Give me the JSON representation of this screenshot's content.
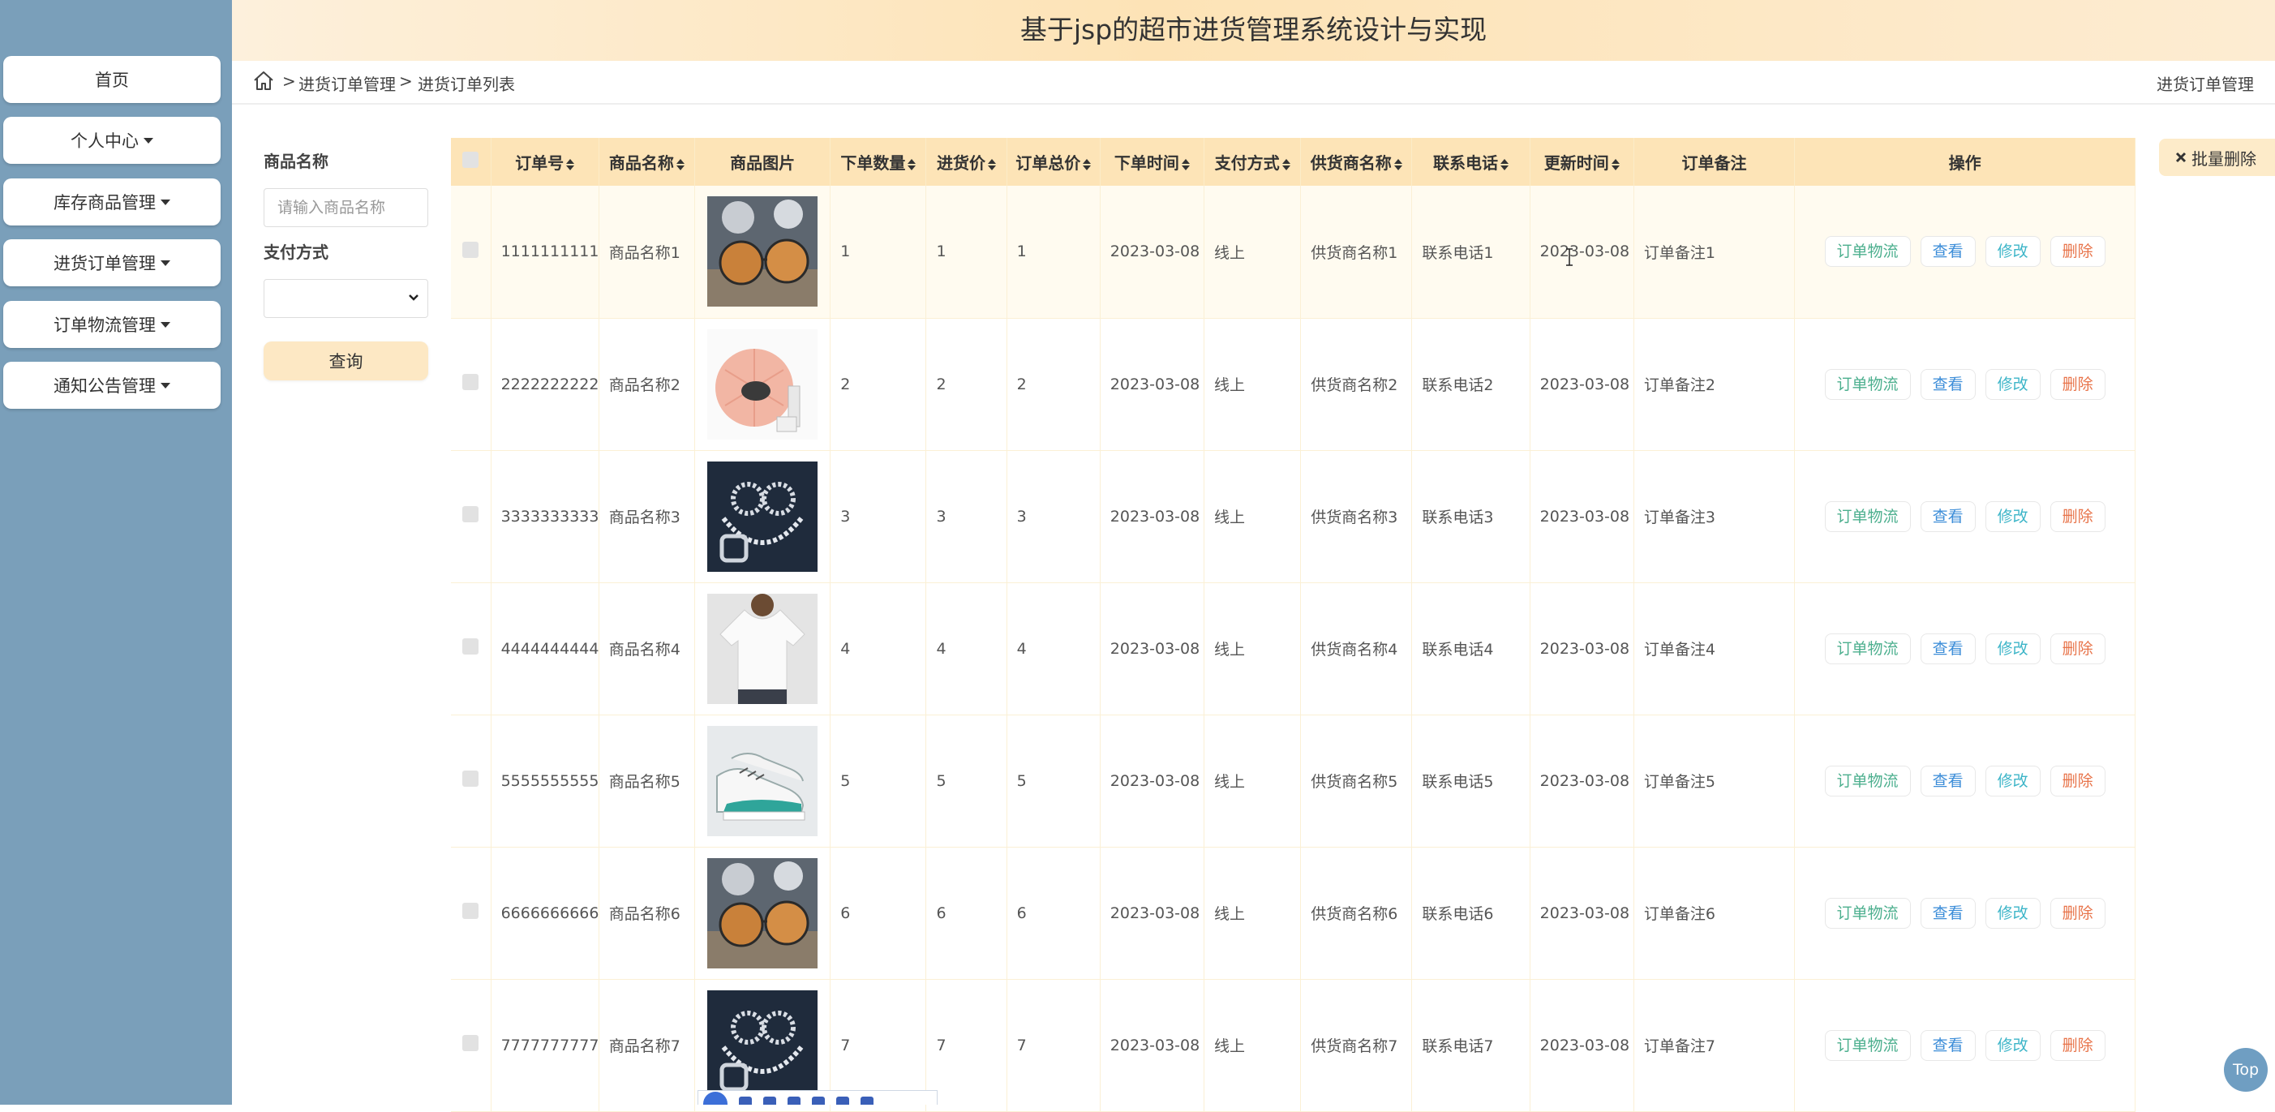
{
  "app": {
    "title": "基于jsp的超市进货管理系统设计与实现"
  },
  "sidebar": {
    "items": [
      {
        "label": "首页",
        "dropdown": false
      },
      {
        "label": "个人中心",
        "dropdown": true
      },
      {
        "label": "库存商品管理",
        "dropdown": true
      },
      {
        "label": "进货订单管理",
        "dropdown": true
      },
      {
        "label": "订单物流管理",
        "dropdown": true
      },
      {
        "label": "通知公告管理",
        "dropdown": true
      }
    ]
  },
  "breadcrumb": {
    "sep1": ">",
    "item1": "进货订单管理",
    "sep2": ">",
    "item2": "进货订单列表",
    "right": "进货订单管理"
  },
  "search": {
    "name_label": "商品名称",
    "name_placeholder": "请输入商品名称",
    "name_value": "",
    "pay_label": "支付方式",
    "pay_value": "",
    "button": "查询"
  },
  "batch_delete": {
    "icon": "times-icon",
    "label": "批量删除"
  },
  "table": {
    "headers": [
      "订单号",
      "商品名称",
      "商品图片",
      "下单数量",
      "进货价",
      "订单总价",
      "下单时间",
      "支付方式",
      "供货商名称",
      "联系电话",
      "更新时间",
      "订单备注",
      "操作"
    ],
    "actions": {
      "logistics": "订单物流",
      "view": "查看",
      "edit": "修改",
      "delete": "删除"
    },
    "rows": [
      {
        "order_no": "1111111111",
        "name": "商品名称1",
        "image": "sunglasses",
        "qty": "1",
        "price": "1",
        "total": "1",
        "date": "2023-03-08",
        "pay": "线上",
        "supplier": "供货商名称1",
        "phone": "联系电话1",
        "updated": "2023-03-08",
        "note": "订单备注1"
      },
      {
        "order_no": "2222222222",
        "name": "商品名称2",
        "image": "cosmetics",
        "qty": "2",
        "price": "2",
        "total": "2",
        "date": "2023-03-08",
        "pay": "线上",
        "supplier": "供货商名称2",
        "phone": "联系电话2",
        "updated": "2023-03-08",
        "note": "订单备注2"
      },
      {
        "order_no": "3333333333",
        "name": "商品名称3",
        "image": "jewelry",
        "qty": "3",
        "price": "3",
        "total": "3",
        "date": "2023-03-08",
        "pay": "线上",
        "supplier": "供货商名称3",
        "phone": "联系电话3",
        "updated": "2023-03-08",
        "note": "订单备注3"
      },
      {
        "order_no": "4444444444",
        "name": "商品名称4",
        "image": "tshirt",
        "qty": "4",
        "price": "4",
        "total": "4",
        "date": "2023-03-08",
        "pay": "线上",
        "supplier": "供货商名称4",
        "phone": "联系电话4",
        "updated": "2023-03-08",
        "note": "订单备注4"
      },
      {
        "order_no": "5555555555",
        "name": "商品名称5",
        "image": "sneakers",
        "qty": "5",
        "price": "5",
        "total": "5",
        "date": "2023-03-08",
        "pay": "线上",
        "supplier": "供货商名称5",
        "phone": "联系电话5",
        "updated": "2023-03-08",
        "note": "订单备注5"
      },
      {
        "order_no": "6666666666",
        "name": "商品名称6",
        "image": "sunglasses",
        "qty": "6",
        "price": "6",
        "total": "6",
        "date": "2023-03-08",
        "pay": "线上",
        "supplier": "供货商名称6",
        "phone": "联系电话6",
        "updated": "2023-03-08",
        "note": "订单备注6"
      },
      {
        "order_no": "7777777777",
        "name": "商品名称7",
        "image": "jewelry",
        "qty": "7",
        "price": "7",
        "total": "7",
        "date": "2023-03-08",
        "pay": "线上",
        "supplier": "供货商名称7",
        "phone": "联系电话7",
        "updated": "2023-03-08",
        "note": "订单备注7"
      }
    ]
  },
  "top_button": "Top",
  "colors": {
    "sidebar": "#7a9fba",
    "header_gradient": "#fde3b6",
    "table_header": "#fde4b7",
    "logistics": "#4caf8e",
    "view": "#3c8dd8",
    "edit": "#3db5c8",
    "delete": "#e8744a"
  }
}
